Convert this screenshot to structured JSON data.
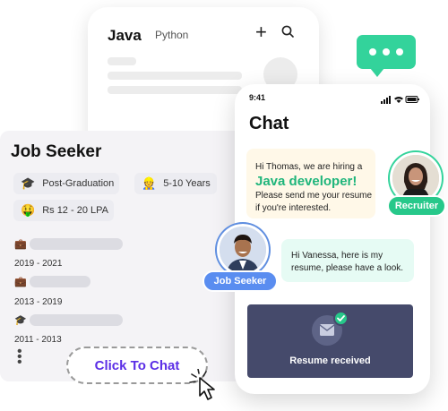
{
  "back_phone": {
    "tabs": [
      "Java",
      "Python"
    ]
  },
  "job_card": {
    "title": "Job Seeker",
    "chips": [
      {
        "icon": "graduation-cap-icon",
        "label": "Post-Graduation"
      },
      {
        "icon": "worker-icon",
        "label": "5-10 Years"
      },
      {
        "icon": "money-face-icon",
        "label": "Rs 12 - 20 LPA"
      }
    ],
    "experience": [
      {
        "icon": "briefcase-icon",
        "years": "2019 - 2021"
      },
      {
        "icon": "briefcase-icon",
        "years": "2013 - 2019"
      },
      {
        "icon": "graduation-cap-icon",
        "years": "2011 - 2013"
      }
    ]
  },
  "click_to_chat": {
    "label": "Click To Chat"
  },
  "chat_phone": {
    "time": "9:41",
    "title": "Chat",
    "received": {
      "line1": "Hi Thomas, we are hiring a",
      "highlight": "Java developer!",
      "line2": "Please send me your resume",
      "line3": "if you're interested."
    },
    "sent": {
      "line1": "Hi Vanessa, here is my",
      "line2": "resume, please have a look."
    },
    "attachment": {
      "label": "Resume received"
    }
  },
  "roles": {
    "recruiter": "Recruiter",
    "job_seeker": "Job Seeker"
  },
  "colors": {
    "accent_green": "#27c88a",
    "accent_blue": "#5a8df0",
    "click_text": "#5b2ee6",
    "resume_box": "#454a6b"
  }
}
